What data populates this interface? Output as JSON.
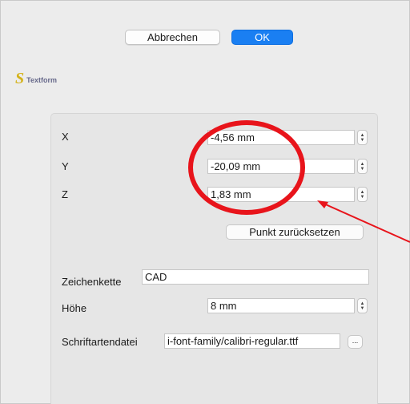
{
  "dialog": {
    "cancel_label": "Abbrechen",
    "ok_label": "OK",
    "title": "Textform",
    "logo_glyph": "S",
    "colors": {
      "ok_button": "#1a7ff2",
      "logo": "#d4b21a",
      "annotation": "#e8141b"
    }
  },
  "coords": {
    "x_label": "X",
    "x_value": "-4,56 mm",
    "y_label": "Y",
    "y_value": "-20,09 mm",
    "z_label": "Z",
    "z_value": "1,83 mm",
    "reset_label": "Punkt zurücksetzen"
  },
  "text": {
    "string_label": "Zeichenkette",
    "string_value": "CAD",
    "height_label": "Höhe",
    "height_value": "8 mm",
    "font_file_label": "Schriftartendatei",
    "font_file_value": "i-font-family/calibri-regular.ttf",
    "browse_label": "..."
  }
}
